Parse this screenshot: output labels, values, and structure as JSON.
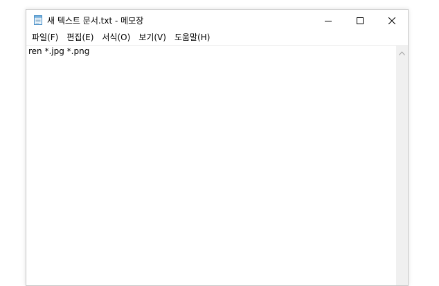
{
  "window": {
    "title": "새 텍스트 문서.txt - 메모장",
    "icon": "notepad-icon"
  },
  "controls": {
    "minimize_icon": "minimize-icon",
    "maximize_icon": "maximize-icon",
    "close_icon": "close-icon"
  },
  "menubar": {
    "items": [
      {
        "label": "파일(F)"
      },
      {
        "label": "편집(E)"
      },
      {
        "label": "서식(O)"
      },
      {
        "label": "보기(V)"
      },
      {
        "label": "도움말(H)"
      }
    ]
  },
  "editor": {
    "content": "ren *.jpg *.png"
  },
  "scrollbar": {
    "up_icon": "chevron-up-icon"
  },
  "colors": {
    "window_border": "#c8c8c8",
    "scrollbar_track": "#f0f0f0",
    "text": "#000000"
  }
}
